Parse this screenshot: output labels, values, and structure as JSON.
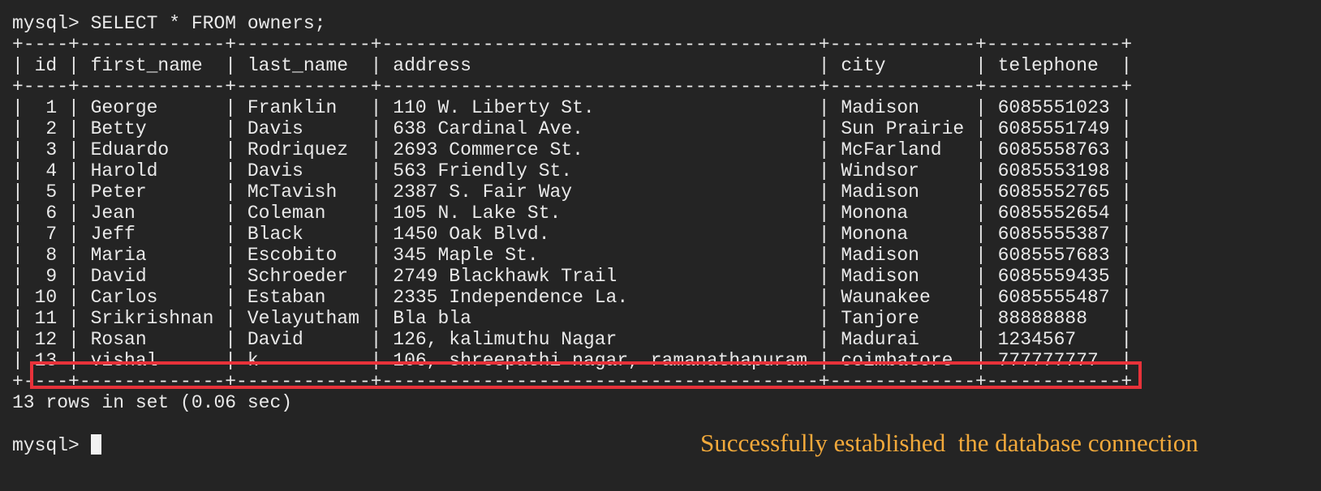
{
  "prompt": "mysql> ",
  "command": "SELECT * FROM owners;",
  "table": {
    "border": "+----+-------------+------------+---------------------------------------+-------------+------------+",
    "header_line": "| id | first_name  | last_name  | address                               | city        | telephone  |",
    "columns": [
      "id",
      "first_name",
      "last_name",
      "address",
      "city",
      "telephone"
    ],
    "rows": [
      {
        "line": "|  1 | George      | Franklin   | 110 W. Liberty St.                    | Madison     | 6085551023 |",
        "values": [
          "1",
          "George",
          "Franklin",
          "110 W. Liberty St.",
          "Madison",
          "6085551023"
        ]
      },
      {
        "line": "|  2 | Betty       | Davis      | 638 Cardinal Ave.                     | Sun Prairie | 6085551749 |",
        "values": [
          "2",
          "Betty",
          "Davis",
          "638 Cardinal Ave.",
          "Sun Prairie",
          "6085551749"
        ]
      },
      {
        "line": "|  3 | Eduardo     | Rodriquez  | 2693 Commerce St.                     | McFarland   | 6085558763 |",
        "values": [
          "3",
          "Eduardo",
          "Rodriquez",
          "2693 Commerce St.",
          "McFarland",
          "6085558763"
        ]
      },
      {
        "line": "|  4 | Harold      | Davis      | 563 Friendly St.                      | Windsor     | 6085553198 |",
        "values": [
          "4",
          "Harold",
          "Davis",
          "563 Friendly St.",
          "Windsor",
          "6085553198"
        ]
      },
      {
        "line": "|  5 | Peter       | McTavish   | 2387 S. Fair Way                      | Madison     | 6085552765 |",
        "values": [
          "5",
          "Peter",
          "McTavish",
          "2387 S. Fair Way",
          "Madison",
          "6085552765"
        ]
      },
      {
        "line": "|  6 | Jean        | Coleman    | 105 N. Lake St.                       | Monona      | 6085552654 |",
        "values": [
          "6",
          "Jean",
          "Coleman",
          "105 N. Lake St.",
          "Monona",
          "6085552654"
        ]
      },
      {
        "line": "|  7 | Jeff        | Black      | 1450 Oak Blvd.                        | Monona      | 6085555387 |",
        "values": [
          "7",
          "Jeff",
          "Black",
          "1450 Oak Blvd.",
          "Monona",
          "6085555387"
        ]
      },
      {
        "line": "|  8 | Maria       | Escobito   | 345 Maple St.                         | Madison     | 6085557683 |",
        "values": [
          "8",
          "Maria",
          "Escobito",
          "345 Maple St.",
          "Madison",
          "6085557683"
        ]
      },
      {
        "line": "|  9 | David       | Schroeder  | 2749 Blackhawk Trail                  | Madison     | 6085559435 |",
        "values": [
          "9",
          "David",
          "Schroeder",
          "2749 Blackhawk Trail",
          "Madison",
          "6085559435"
        ]
      },
      {
        "line": "| 10 | Carlos      | Estaban    | 2335 Independence La.                 | Waunakee    | 6085555487 |",
        "values": [
          "10",
          "Carlos",
          "Estaban",
          "2335 Independence La.",
          "Waunakee",
          "6085555487"
        ]
      },
      {
        "line": "| 11 | Srikrishnan | Velayutham | Bla bla                               | Tanjore     | 88888888   |",
        "values": [
          "11",
          "Srikrishnan",
          "Velayutham",
          "Bla bla",
          "Tanjore",
          "88888888"
        ]
      },
      {
        "line": "| 12 | Rosan       | David      | 126, kalimuthu Nagar                  | Madurai     | 1234567    |",
        "values": [
          "12",
          "Rosan",
          "David",
          "126, kalimuthu Nagar",
          "Madurai",
          "1234567"
        ]
      },
      {
        "line": "| 13 | vishal      | k          | 106, shreepathi nagar, ramanathapuram | coimbatore  | 777777777  |",
        "values": [
          "13",
          "vishal",
          "k",
          "106, shreepathi nagar, ramanathapuram",
          "coimbatore",
          "777777777"
        ]
      }
    ]
  },
  "result_summary": "13 rows in set (0.06 sec)",
  "annotation": "Successfully established  the database connection",
  "colors": {
    "background": "#242424",
    "text": "#e9e9e9",
    "highlight_border": "#e8323a",
    "annotation_text": "#f2a93b"
  }
}
